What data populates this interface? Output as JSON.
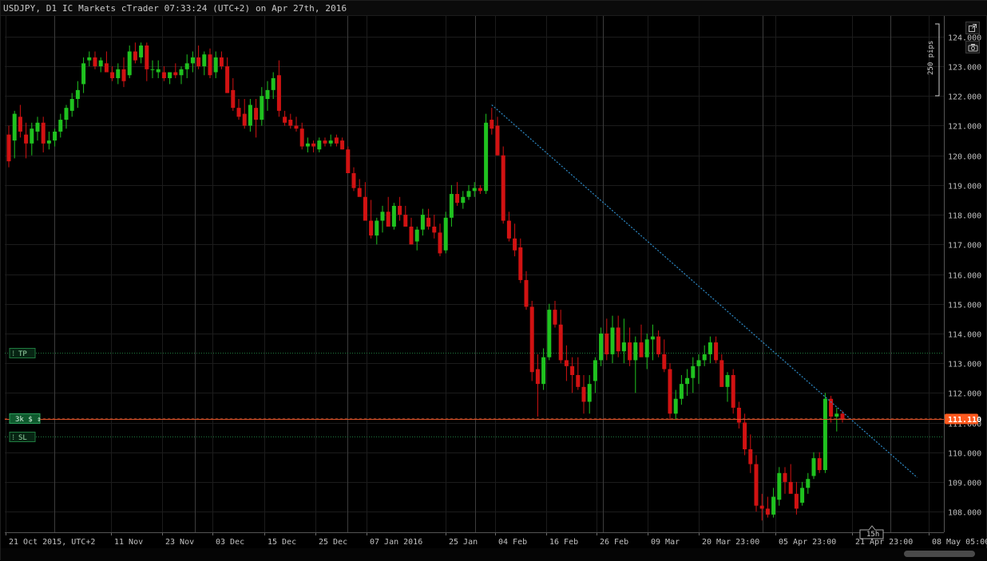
{
  "window": {
    "title": "USDJPY, D1 IC Markets cTrader 07:33:24 (UTC+2) on Apr 27th, 2016"
  },
  "toolbar": {
    "detach_icon": "detach-icon",
    "camera_icon": "camera-icon"
  },
  "ruler": {
    "label": "250 pips"
  },
  "markers": {
    "tp_label": "TP",
    "sl_label": "SL",
    "position_label": "3k $ ⇕",
    "current_price": "111.110"
  },
  "countdown": "15h",
  "colors": {
    "bull": "#1fc21f",
    "bear": "#d11212",
    "price_line": "#e0552a",
    "price_tag": "#ff5a1f",
    "marker": "#0f5a2e",
    "trendline": "#2e8bc8",
    "grid": "#1c1c1c",
    "separator": "#3c3c3c"
  },
  "chart_data": {
    "type": "candlestick",
    "symbol": "USDJPY",
    "timeframe": "D1",
    "ylim": [
      107.6,
      124.4
    ],
    "y_ticks": [
      "124.000",
      "123.000",
      "122.000",
      "121.000",
      "120.000",
      "119.000",
      "118.000",
      "117.000",
      "116.000",
      "115.000",
      "114.000",
      "113.000",
      "112.000",
      "111.000",
      "110.000",
      "109.000",
      "108.000"
    ],
    "x_ticks": [
      "21 Oct 2015, UTC+2",
      "11 Nov",
      "23 Nov",
      "03 Dec",
      "15 Dec",
      "25 Dec",
      "07 Jan 2016",
      "25 Jan",
      "04 Feb",
      "16 Feb",
      "26 Feb",
      "09 Mar",
      "20 Mar 23:00",
      "05 Apr 23:00",
      "21 Apr 23:00",
      "08 May 05:00"
    ],
    "current_price": 111.11,
    "take_profit": 113.35,
    "stop_loss": 110.52,
    "position_price": 111.15,
    "trendline": {
      "from_index": 84,
      "from_price": 121.7,
      "to_index": 158,
      "to_price": 109.15
    },
    "candles": [
      [
        120.7,
        121.0,
        119.6,
        119.8
      ],
      [
        120.5,
        121.5,
        119.9,
        121.4
      ],
      [
        121.3,
        121.7,
        120.6,
        120.8
      ],
      [
        120.7,
        121.1,
        119.9,
        120.4
      ],
      [
        120.4,
        121.1,
        120.0,
        120.9
      ],
      [
        120.8,
        121.3,
        120.5,
        121.1
      ],
      [
        121.1,
        121.3,
        120.1,
        120.4
      ],
      [
        120.4,
        120.8,
        120.2,
        120.5
      ],
      [
        120.5,
        120.9,
        120.3,
        120.8
      ],
      [
        120.8,
        121.4,
        120.6,
        121.2
      ],
      [
        121.2,
        121.7,
        120.9,
        121.6
      ],
      [
        121.5,
        122.1,
        121.3,
        121.9
      ],
      [
        121.9,
        122.5,
        121.6,
        122.2
      ],
      [
        122.4,
        123.3,
        122.1,
        123.1
      ],
      [
        123.2,
        123.5,
        123.0,
        123.3
      ],
      [
        123.3,
        123.5,
        122.9,
        123.0
      ],
      [
        123.0,
        123.3,
        122.8,
        123.2
      ],
      [
        123.1,
        123.5,
        122.9,
        122.8
      ],
      [
        122.8,
        123.0,
        122.5,
        122.6
      ],
      [
        122.6,
        123.1,
        122.4,
        122.9
      ],
      [
        122.9,
        123.3,
        122.3,
        122.5
      ],
      [
        122.7,
        123.7,
        122.6,
        123.5
      ],
      [
        123.5,
        123.8,
        123.1,
        123.2
      ],
      [
        123.3,
        123.8,
        123.1,
        123.7
      ],
      [
        123.7,
        123.8,
        122.5,
        122.9
      ],
      [
        122.9,
        123.2,
        122.6,
        122.9
      ],
      [
        122.8,
        123.2,
        122.6,
        122.9
      ],
      [
        122.8,
        123.0,
        122.5,
        122.6
      ],
      [
        122.6,
        122.8,
        122.4,
        122.8
      ],
      [
        122.8,
        123.1,
        122.6,
        122.7
      ],
      [
        122.7,
        123.0,
        122.4,
        122.9
      ],
      [
        122.9,
        123.4,
        122.6,
        123.1
      ],
      [
        123.1,
        123.5,
        122.8,
        123.3
      ],
      [
        123.3,
        123.7,
        122.9,
        123.0
      ],
      [
        123.0,
        123.5,
        122.7,
        123.4
      ],
      [
        123.4,
        123.6,
        122.6,
        122.7
      ],
      [
        122.8,
        123.5,
        122.6,
        123.3
      ],
      [
        123.3,
        123.5,
        122.9,
        123.0
      ],
      [
        123.0,
        123.3,
        122.1,
        122.1
      ],
      [
        122.2,
        122.6,
        121.5,
        121.6
      ],
      [
        121.6,
        121.9,
        121.2,
        121.3
      ],
      [
        121.4,
        121.9,
        120.9,
        121.0
      ],
      [
        121.0,
        121.9,
        120.8,
        121.7
      ],
      [
        121.6,
        121.9,
        120.6,
        121.2
      ],
      [
        121.2,
        122.3,
        121.0,
        122.0
      ],
      [
        121.9,
        122.5,
        121.5,
        122.2
      ],
      [
        122.2,
        122.8,
        121.9,
        122.6
      ],
      [
        122.7,
        123.2,
        121.3,
        121.5
      ],
      [
        121.3,
        121.5,
        121.0,
        121.1
      ],
      [
        121.2,
        121.4,
        120.9,
        121.0
      ],
      [
        121.0,
        121.3,
        120.8,
        120.9
      ],
      [
        120.9,
        121.1,
        120.2,
        120.3
      ],
      [
        120.3,
        120.6,
        120.1,
        120.4
      ],
      [
        120.4,
        120.5,
        120.1,
        120.3
      ],
      [
        120.2,
        120.6,
        120.1,
        120.5
      ],
      [
        120.5,
        120.6,
        120.3,
        120.4
      ],
      [
        120.4,
        120.7,
        120.3,
        120.5
      ],
      [
        120.6,
        120.7,
        120.3,
        120.4
      ],
      [
        120.5,
        120.6,
        120.2,
        120.2
      ],
      [
        120.2,
        120.3,
        119.4,
        119.4
      ],
      [
        119.4,
        119.6,
        118.8,
        118.9
      ],
      [
        118.9,
        119.2,
        118.7,
        118.6
      ],
      [
        118.6,
        119.1,
        117.9,
        117.8
      ],
      [
        117.8,
        118.5,
        117.2,
        117.3
      ],
      [
        117.3,
        117.9,
        117.0,
        117.8
      ],
      [
        117.8,
        118.3,
        117.4,
        118.1
      ],
      [
        118.1,
        118.6,
        117.6,
        117.6
      ],
      [
        117.6,
        118.4,
        117.5,
        118.3
      ],
      [
        118.3,
        118.6,
        117.8,
        118.0
      ],
      [
        118.0,
        118.3,
        117.6,
        117.6
      ],
      [
        117.6,
        117.9,
        117.0,
        117.0
      ],
      [
        117.1,
        117.6,
        116.8,
        117.5
      ],
      [
        117.5,
        118.2,
        117.3,
        118.0
      ],
      [
        117.9,
        118.2,
        117.5,
        117.6
      ],
      [
        117.6,
        118.0,
        117.2,
        117.4
      ],
      [
        117.4,
        117.7,
        116.6,
        116.7
      ],
      [
        116.8,
        118.1,
        116.7,
        117.9
      ],
      [
        117.9,
        119.0,
        117.6,
        118.7
      ],
      [
        118.7,
        119.1,
        118.3,
        118.4
      ],
      [
        118.4,
        118.8,
        118.2,
        118.6
      ],
      [
        118.6,
        119.0,
        118.5,
        118.8
      ],
      [
        118.8,
        119.1,
        118.6,
        118.9
      ],
      [
        118.9,
        119.0,
        118.7,
        118.8
      ],
      [
        118.8,
        121.4,
        118.7,
        121.1
      ],
      [
        121.2,
        121.6,
        120.7,
        120.9
      ],
      [
        121.0,
        121.3,
        120.0,
        120.0
      ],
      [
        120.0,
        120.3,
        117.7,
        117.8
      ],
      [
        117.8,
        118.1,
        117.1,
        117.2
      ],
      [
        117.2,
        117.7,
        116.6,
        116.8
      ],
      [
        116.9,
        117.2,
        115.7,
        115.8
      ],
      [
        115.8,
        116.1,
        114.8,
        114.9
      ],
      [
        114.9,
        115.1,
        112.4,
        112.7
      ],
      [
        112.8,
        113.3,
        111.2,
        112.3
      ],
      [
        112.3,
        113.5,
        112.1,
        113.2
      ],
      [
        113.2,
        115.0,
        113.1,
        114.8
      ],
      [
        114.8,
        115.1,
        114.2,
        114.3
      ],
      [
        114.3,
        114.8,
        113.0,
        113.1
      ],
      [
        113.1,
        113.6,
        112.4,
        112.9
      ],
      [
        112.9,
        113.2,
        112.0,
        112.6
      ],
      [
        112.6,
        113.2,
        112.1,
        112.2
      ],
      [
        112.2,
        112.6,
        111.3,
        111.7
      ],
      [
        111.7,
        112.6,
        111.3,
        112.3
      ],
      [
        112.4,
        113.2,
        112.0,
        113.1
      ],
      [
        113.1,
        114.2,
        112.9,
        114.0
      ],
      [
        114.0,
        114.5,
        113.1,
        113.3
      ],
      [
        113.3,
        114.6,
        113.0,
        114.2
      ],
      [
        114.2,
        114.6,
        113.2,
        113.4
      ],
      [
        113.4,
        114.5,
        113.0,
        113.7
      ],
      [
        113.7,
        114.2,
        112.9,
        113.1
      ],
      [
        113.1,
        113.9,
        112.0,
        113.7
      ],
      [
        113.7,
        114.3,
        113.4,
        113.2
      ],
      [
        113.2,
        114.0,
        112.8,
        113.8
      ],
      [
        113.8,
        114.3,
        113.1,
        113.9
      ],
      [
        113.9,
        114.1,
        113.2,
        113.3
      ],
      [
        113.3,
        113.8,
        112.7,
        112.8
      ],
      [
        112.8,
        113.0,
        111.1,
        111.3
      ],
      [
        111.3,
        112.1,
        111.1,
        111.8
      ],
      [
        111.8,
        112.6,
        111.6,
        112.3
      ],
      [
        112.3,
        112.8,
        111.9,
        112.5
      ],
      [
        112.5,
        113.2,
        112.0,
        112.9
      ],
      [
        112.9,
        113.3,
        112.3,
        113.1
      ],
      [
        113.1,
        113.6,
        112.9,
        113.3
      ],
      [
        113.3,
        113.9,
        113.0,
        113.7
      ],
      [
        113.7,
        113.9,
        113.0,
        113.1
      ],
      [
        113.1,
        113.3,
        112.2,
        112.2
      ],
      [
        112.2,
        112.7,
        111.7,
        112.6
      ],
      [
        112.6,
        112.8,
        111.3,
        111.5
      ],
      [
        111.5,
        111.7,
        110.8,
        111.0
      ],
      [
        111.0,
        111.3,
        109.9,
        110.1
      ],
      [
        110.1,
        110.6,
        109.3,
        109.6
      ],
      [
        109.6,
        109.9,
        108.0,
        108.2
      ],
      [
        108.2,
        108.6,
        107.7,
        108.1
      ],
      [
        108.1,
        108.5,
        107.8,
        107.9
      ],
      [
        107.9,
        108.8,
        107.8,
        108.5
      ],
      [
        108.4,
        109.5,
        108.2,
        109.3
      ],
      [
        109.3,
        109.5,
        108.6,
        109.0
      ],
      [
        109.0,
        109.6,
        108.8,
        108.6
      ],
      [
        108.6,
        109.0,
        107.9,
        108.1
      ],
      [
        108.3,
        109.0,
        108.2,
        108.8
      ],
      [
        108.8,
        109.3,
        108.6,
        109.1
      ],
      [
        109.2,
        110.0,
        109.1,
        109.8
      ],
      [
        109.8,
        110.0,
        109.3,
        109.4
      ],
      [
        109.4,
        112.0,
        109.3,
        111.8
      ],
      [
        111.8,
        111.9,
        111.0,
        111.2
      ],
      [
        111.2,
        111.5,
        110.7,
        111.3
      ],
      [
        111.3,
        111.4,
        111.0,
        111.1
      ]
    ]
  }
}
